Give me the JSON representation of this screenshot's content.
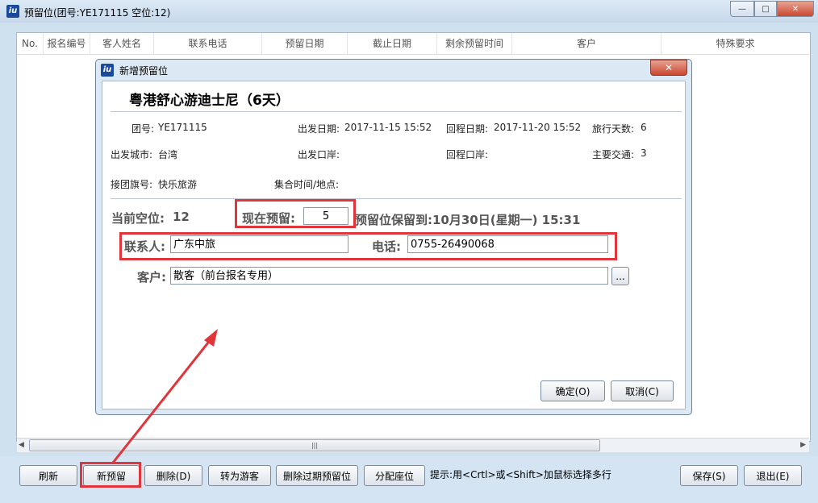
{
  "window": {
    "title": "预留位(团号:YE171115  空位:12)",
    "min_icon": "minimize-icon",
    "max_icon": "maximize-icon",
    "close_icon": "close-icon",
    "glyphs": {
      "min": "—",
      "max": "□",
      "close": "✕"
    }
  },
  "grid": {
    "columns": [
      "No.",
      "报名编号",
      "客人姓名",
      "联系电话",
      "预留日期",
      "截止日期",
      "剩余预留时间",
      "客户",
      "特殊要求"
    ],
    "rows": [],
    "scroll": {
      "left": "◀",
      "right": "▶",
      "thumb_grip": "|||"
    }
  },
  "dialog": {
    "title": "新增预留位",
    "close_glyph": "✕",
    "tour_name": "粤港舒心游迪士尼（6天）",
    "info": {
      "group_no_label": "团号:",
      "group_no": "YE171115",
      "depart_date_label": "出发日期:",
      "depart_date": "2017-11-15 15:52",
      "return_date_label": "回程日期:",
      "return_date": "2017-11-20 15:52",
      "days_label": "旅行天数:",
      "days": "6",
      "depart_city_label": "出发城市:",
      "depart_city": "台湾",
      "depart_port_label": "出发口岸:",
      "return_port_label": "回程口岸:",
      "transport_label": "主要交通:",
      "transport": "3",
      "flag_label": "接团旗号:",
      "flag": "快乐旅游",
      "meet_label": "集合时间/地点:"
    },
    "current_vacancy_label": "当前空位:",
    "current_vacancy": "12",
    "reserve_now_label": "现在预留:",
    "reserve_now_value": "5",
    "hold_until": "预留位保留到:10月30日(星期一) 15:31",
    "contact_label": "联系人:",
    "contact_value": "广东中旅",
    "phone_label": "电话:",
    "phone_value": "0755-26490068",
    "customer_label": "客户:",
    "customer_value": "散客（前台报名专用）",
    "browse_label": "...",
    "ok_label": "确定(O)",
    "cancel_label": "取消(C)"
  },
  "toolbar": {
    "refresh": "刷新",
    "new_reserve": "新预留",
    "delete": "删除(D)",
    "to_tourist": "转为游客",
    "delete_expired": "删除过期预留位",
    "assign_seat": "分配座位",
    "hint": "提示:用<Crtl>或<Shift>加鼠标选择多行",
    "save": "保存(S)",
    "exit": "退出(E)"
  },
  "colors": {
    "highlight": "#e0353a",
    "accent": "#1a4a9c"
  }
}
